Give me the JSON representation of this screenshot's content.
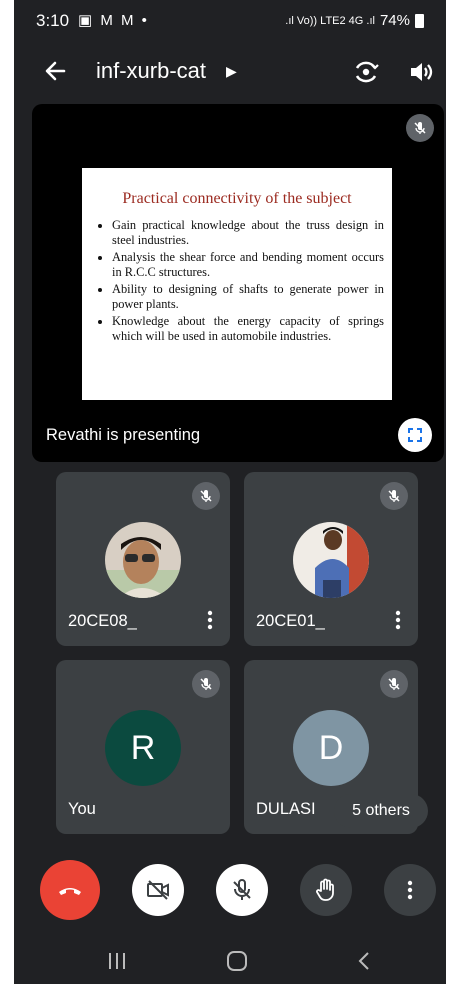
{
  "status_bar": {
    "time": "3:10",
    "notification_icons": "▣ M M •",
    "network_text": ".ıl Vo)) LTE2 4G .ıl",
    "battery": "74%"
  },
  "header": {
    "meeting_code": "inf-xurb-cat",
    "icons": [
      "back-arrow-icon",
      "switch-camera-icon",
      "speaker-icon"
    ]
  },
  "presentation": {
    "slide_title": "Practical connectivity of the subject",
    "slide_bullets": [
      "Gain practical knowledge about the truss design in steel industries.",
      "Analysis the shear force and bending moment occurs in R.C.C structures.",
      "Ability to designing of shafts to generate power in power plants.",
      "Knowledge about the energy capacity of springs which will be used in automobile industries."
    ],
    "presenter_label": "Revathi is presenting"
  },
  "participants": [
    {
      "name": "20CE08_",
      "type": "photo"
    },
    {
      "name": "20CE01_",
      "type": "photo"
    },
    {
      "name": "You",
      "initial": "R",
      "color": "#0b4a3f"
    },
    {
      "name": "DULASI",
      "initial": "D",
      "color": "#7f95a3"
    }
  ],
  "others_label": "5 others",
  "controls": {
    "end_call_color": "#ea4335",
    "icons": [
      "end-call-icon",
      "camera-off-icon",
      "mic-off-icon",
      "raise-hand-icon",
      "more-options-icon"
    ]
  }
}
